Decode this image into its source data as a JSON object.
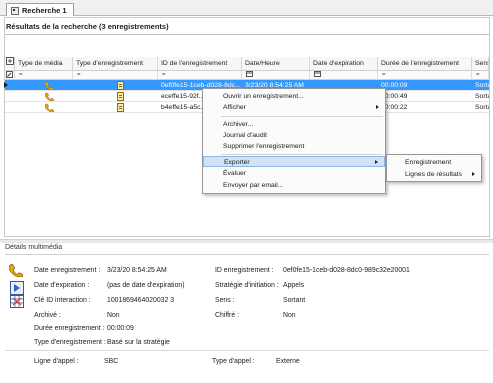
{
  "tab": {
    "label": "Recherche 1"
  },
  "results": {
    "title": "Résultats de la recherche (3 enregistrements)"
  },
  "grid": {
    "columns": [
      "Type de média",
      "Type d'enregistrement",
      "ID de l'enregistrement",
      "Date/Heure",
      "Date d'expiration",
      "Durée de l'enregistrement",
      "Sens"
    ],
    "rows": [
      {
        "id": "0ef0fe15-1ceb-d028-8dc...",
        "date": "3/23/20 8:54:25 AM",
        "duration": "00:00:09",
        "sens": "Sortan",
        "selected": true
      },
      {
        "id": "eceffe15-92f...",
        "date": "",
        "duration": "00:00:49",
        "sens": "Sortan",
        "selected": false
      },
      {
        "id": "b4effe15-a5c...",
        "date": "",
        "duration": "00:00:22",
        "sens": "Sortan",
        "selected": false
      }
    ]
  },
  "context_menu": {
    "items": [
      "Ouvrir un enregistrement...",
      "Afficher",
      "Archiver...",
      "Journal d'audit",
      "Supprimer l'enregistrement",
      "Exporter",
      "Évaluer",
      "Envoyer par email..."
    ],
    "highlighted": "Exporter"
  },
  "submenu": {
    "items": [
      "Enregistrement",
      "Lignes de résultats"
    ]
  },
  "details": {
    "title": "Détails multimédia",
    "left": [
      {
        "label": "Date enregistrement :",
        "value": "3/23/20 8:54:25 AM"
      },
      {
        "label": "Date d'expiration :",
        "value": "(pas de date d'expiration)"
      },
      {
        "label": "Clé ID interaction :",
        "value": "1001869464020032 3"
      },
      {
        "label": "Archivé :",
        "value": "Non"
      },
      {
        "label": "Durée enregistrement :",
        "value": "00:00:09"
      },
      {
        "label": "Type d'enregistrement :",
        "value": "Basé sur la stratégie"
      }
    ],
    "right": [
      {
        "label": "ID enregistrement :",
        "value": "0ef0fe15-1ceb-d028-8dc0-989c32e20001"
      },
      {
        "label": "Stratégie d'initiation :",
        "value": "Appels"
      },
      {
        "label": "Sens :",
        "value": "Sortant"
      },
      {
        "label": "Chiffré :",
        "value": "Non"
      }
    ],
    "ligne_label": "Ligne d'appel :",
    "ligne_value": "SBC",
    "type_appel_label": "Type d'appel :",
    "type_appel_value": "Externe"
  },
  "colors": {
    "selection": "#3399ff",
    "menu_highlight": "#cfe3f7",
    "phone": "#e8a11a"
  }
}
